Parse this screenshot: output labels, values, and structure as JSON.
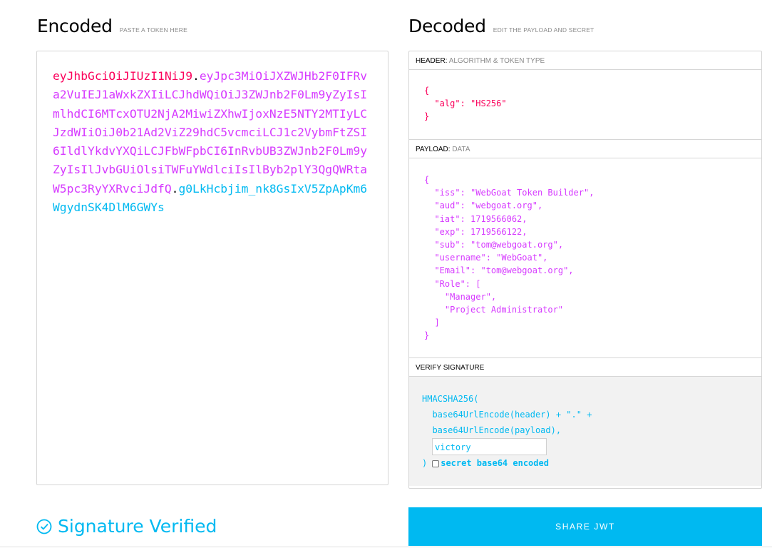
{
  "encoded": {
    "title": "Encoded",
    "hint": "PASTE A TOKEN HERE",
    "token_header": "eyJhbGciOiJIUzI1NiJ9",
    "token_payload": "eyJpc3MiOiJXZWJHb2F0IFRva2VuIEJ1aWxkZXIiLCJhdWQiOiJ3ZWJnb2F0Lm9yZyIsImlhdCI6MTcxOTU2NjA2MiwiZXhwIjoxNzE5NTY2MTIyLCJzdWIiOiJ0b21Ad2ViZ29hdC5vcmciLCJ1c2VybmFtZSI6IldlYkdvYXQiLCJFbWFpbCI6InRvbUB3ZWJnb2F0Lm9yZyIsIlJvbGUiOlsiTWFuYWdlciIsIlByb2plY3QgQWRtaW5pc3RyYXRvciJdfQ",
    "token_signature": "g0LkHcbjim_nk8GsIxV5ZpApKm6WgydnSK4DlM6GWYs",
    "dot": "."
  },
  "decoded": {
    "title": "Decoded",
    "hint": "EDIT THE PAYLOAD AND SECRET",
    "header_section": {
      "label": "HEADER:",
      "sublabel": "ALGORITHM & TOKEN TYPE"
    },
    "header_json": "{\n  \"alg\": \"HS256\"\n}",
    "payload_section": {
      "label": "PAYLOAD:",
      "sublabel": "DATA"
    },
    "payload_json": "{\n  \"iss\": \"WebGoat Token Builder\",\n  \"aud\": \"webgoat.org\",\n  \"iat\": 1719566062,\n  \"exp\": 1719566122,\n  \"sub\": \"tom@webgoat.org\",\n  \"username\": \"WebGoat\",\n  \"Email\": \"tom@webgoat.org\",\n  \"Role\": [\n    \"Manager\",\n    \"Project Administrator\"\n  ]\n}",
    "signature_section": {
      "label": "VERIFY SIGNATURE"
    },
    "signature": {
      "line1": "HMACSHA256(",
      "line2": "  base64UrlEncode(header) + \".\" +",
      "line3": "  base64UrlEncode(payload),",
      "secret_value": "victory",
      "close": ")",
      "base64_label": "secret base64 encoded",
      "base64_checked": false
    }
  },
  "status": {
    "text": "Signature Verified",
    "icon": "check-circle-icon"
  },
  "share_button": "SHARE JWT",
  "colors": {
    "header": "#fb015b",
    "payload": "#d63aff",
    "signature": "#00b9f1"
  }
}
